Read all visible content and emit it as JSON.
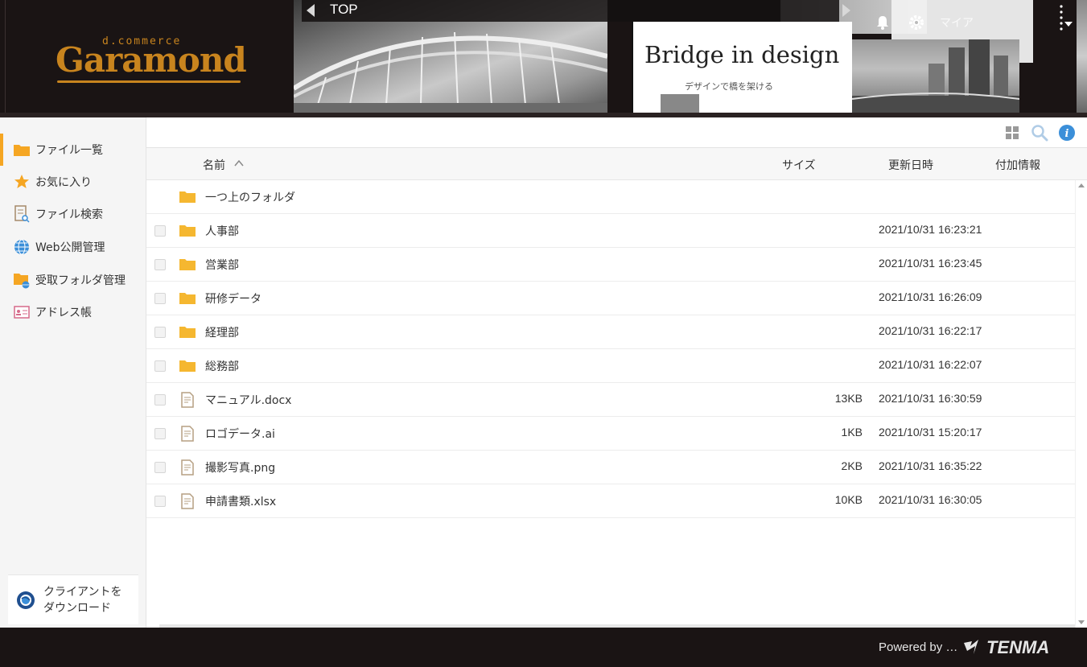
{
  "header": {
    "logo": {
      "sub": "d.commerce",
      "main": "Garamond"
    },
    "breadcrumb": "TOP",
    "banner": {
      "title": "Bridge in design",
      "subtitle": "デザインで橋を架ける"
    },
    "user_label": "マイア"
  },
  "sidebar": {
    "items": [
      {
        "label": "ファイル一覧",
        "icon": "folder-icon",
        "active": true
      },
      {
        "label": "お気に入り",
        "icon": "star-icon",
        "active": false
      },
      {
        "label": "ファイル検索",
        "icon": "file-search-icon",
        "active": false
      },
      {
        "label": "Web公開管理",
        "icon": "globe-icon",
        "active": false
      },
      {
        "label": "受取フォルダ管理",
        "icon": "inbox-folder-icon",
        "active": false
      },
      {
        "label": "アドレス帳",
        "icon": "address-card-icon",
        "active": false
      }
    ],
    "client_download": "クライアントを\nダウンロード"
  },
  "columns": {
    "name": "名前",
    "size": "サイズ",
    "updated": "更新日時",
    "extra": "付加情報"
  },
  "parent_folder": "一つ上のフォルダ",
  "files": [
    {
      "name": "人事部",
      "type": "folder",
      "size": "",
      "updated": "2021/10/31 16:23:21"
    },
    {
      "name": "営業部",
      "type": "folder",
      "size": "",
      "updated": "2021/10/31 16:23:45"
    },
    {
      "name": "研修データ",
      "type": "folder",
      "size": "",
      "updated": "2021/10/31 16:26:09"
    },
    {
      "name": "経理部",
      "type": "folder",
      "size": "",
      "updated": "2021/10/31 16:22:17"
    },
    {
      "name": "総務部",
      "type": "folder",
      "size": "",
      "updated": "2021/10/31 16:22:07"
    },
    {
      "name": "マニュアル.docx",
      "type": "file",
      "size": "13KB",
      "updated": "2021/10/31 16:30:59"
    },
    {
      "name": "ロゴデータ.ai",
      "type": "file",
      "size": "1KB",
      "updated": "2021/10/31 15:20:17"
    },
    {
      "name": "撮影写真.png",
      "type": "file",
      "size": "2KB",
      "updated": "2021/10/31 16:35:22"
    },
    {
      "name": "申請書類.xlsx",
      "type": "file",
      "size": "10KB",
      "updated": "2021/10/31 16:30:05"
    }
  ],
  "footer": {
    "powered": "Powered by …",
    "brand": "TENMA"
  },
  "colors": {
    "accent": "#f5a623",
    "brand": "#c8841e",
    "header_bg": "#1a1414",
    "info_blue": "#3b8fd9"
  }
}
